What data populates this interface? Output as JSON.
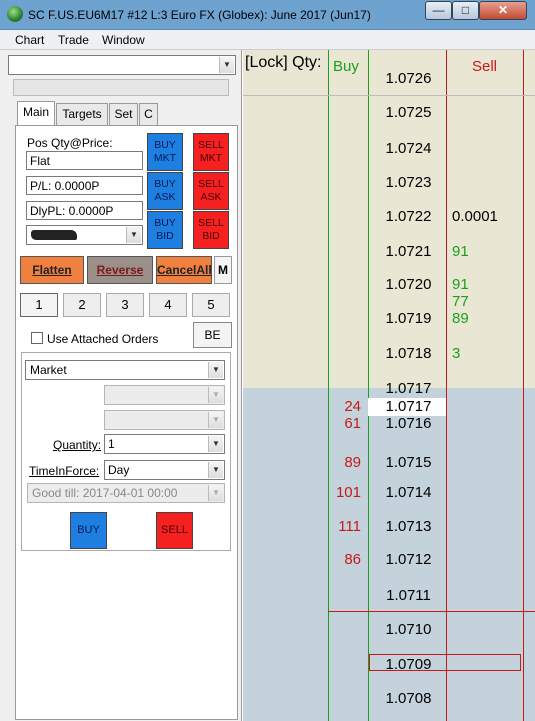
{
  "window": {
    "title": "SC F.US.EU6M17  #12  L:3  Euro FX (Globex): June 2017 (Jun17)",
    "minimize": "—",
    "maximize": "□",
    "close": "✕"
  },
  "menu": [
    "Chart",
    "Trade",
    "Window"
  ],
  "tabs": [
    "Main",
    "Targets",
    "Set",
    "C"
  ],
  "main": {
    "pos_label": "Pos Qty@Price:",
    "pos_value": "Flat",
    "pl_value": "P/L: 0.0000P",
    "dlypl_value": "DlyPL: 0.0000P",
    "account_value": "",
    "buy_mkt": [
      "BUY",
      "MKT"
    ],
    "sell_mkt": [
      "SELL",
      "MKT"
    ],
    "buy_ask": [
      "BUY",
      "ASK"
    ],
    "sell_ask": [
      "SELL",
      "ASK"
    ],
    "buy_bid": [
      "BUY",
      "BID"
    ],
    "sell_bid": [
      "SELL",
      "BID"
    ],
    "flatten": "Flatten",
    "reverse": "Reverse",
    "cancel_all": "CancelAll",
    "m_button": "M",
    "qty_buttons": [
      "1",
      "2",
      "3",
      "4",
      "5"
    ],
    "use_attached_label": "Use Attached Orders",
    "be_button": "BE",
    "order_type": "Market",
    "quantity_label": "Quantity:",
    "quantity_value": "1",
    "tif_label": "TimeInForce:",
    "tif_value": "Day",
    "good_till": "Good till: 2017-04-01 00:00",
    "buy_label": "BUY",
    "sell_label": "SELL"
  },
  "dom": {
    "lock_qty": "[Lock] Qty:",
    "buy_header": "Buy",
    "sell_header": "Sell",
    "colors": {
      "upper_bg": "#e9e6d3",
      "lower_bg": "#c4d3db",
      "buy": "#1aa01a",
      "sell": "#c41a1a"
    },
    "rows": [
      {
        "price": "1.0726",
        "bid": "",
        "ask": ""
      },
      {
        "price": "1.0725",
        "bid": "",
        "ask": ""
      },
      {
        "price": "1.0724",
        "bid": "",
        "ask": ""
      },
      {
        "price": "1.0723",
        "bid": "",
        "ask": ""
      },
      {
        "price": "1.0722",
        "bid": "",
        "ask": "0.0001"
      },
      {
        "price": "1.0721",
        "bid": "",
        "ask": "91"
      },
      {
        "price": "1.0720",
        "bid": "",
        "ask": "91"
      },
      {
        "price": "",
        "bid": "",
        "ask": "77"
      },
      {
        "price": "1.0719",
        "bid": "",
        "ask": "89"
      },
      {
        "price": "1.0718",
        "bid": "",
        "ask": "3"
      },
      {
        "price": "1.0717",
        "bid": "",
        "ask": ""
      },
      {
        "price": "1.0717",
        "bid": "24",
        "ask": ""
      },
      {
        "price": "1.0716",
        "bid": "61",
        "ask": ""
      },
      {
        "price": "1.0715",
        "bid": "89",
        "ask": ""
      },
      {
        "price": "1.0714",
        "bid": "101",
        "ask": ""
      },
      {
        "price": "1.0713",
        "bid": "111",
        "ask": ""
      },
      {
        "price": "1.0712",
        "bid": "86",
        "ask": ""
      },
      {
        "price": "1.0711",
        "bid": "",
        "ask": ""
      },
      {
        "price": "1.0710",
        "bid": "",
        "ask": ""
      },
      {
        "price": "1.0709",
        "bid": "",
        "ask": ""
      },
      {
        "price": "1.0708",
        "bid": "",
        "ask": ""
      }
    ]
  }
}
